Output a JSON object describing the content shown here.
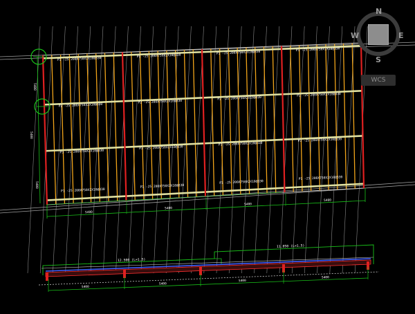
{
  "navigation": {
    "compass": {
      "north": "N",
      "south": "S",
      "east": "E",
      "west": "W"
    },
    "ucs_button_label": "WCS"
  },
  "colors": {
    "background": "#000000",
    "joist": "#f2a51a",
    "beam": "#e0e0a0",
    "column": "#e02020",
    "dimension": "#19c219",
    "grid": "#bfbfbf"
  },
  "plan": {
    "beam_labels": [
      "P1 -25 200X750X2X10@330",
      "P1 -25 200X750X2X10@330",
      "P1 -25 200X750X2X10@330",
      "P1 -25 200X750X2X10@330",
      "P2 -25 200X750X2X10@330",
      "P2 -25 200X750X2X10@330",
      "P2 -25 200X750X2X10@330",
      "P2 -25 200X750X2X10@330",
      "P3 -25 200X750X2X10@330",
      "P3 -25 200X750X2X10@330",
      "P3 -25 200X750X2X10@330",
      "P3 -25 200X750X2X10@330",
      "P1 -25 200X750X2X10@330",
      "P1 -25 200X750X2X10@330",
      "P1 -25 200X750X2X10@330",
      "P1 -25 200X750X2X10@330"
    ],
    "dimension_labels": [
      "5400",
      "5400",
      "5400",
      "5400"
    ],
    "side_dims": [
      "5400",
      "5400",
      "5400"
    ],
    "grid_bubbles": [
      "A",
      "B"
    ]
  },
  "section": {
    "level_labels": [
      "12.500 (L=1.5)",
      "11.050 (L=1.5)"
    ],
    "bottom_dims": [
      "5400",
      "5400",
      "5400",
      "5400"
    ]
  }
}
